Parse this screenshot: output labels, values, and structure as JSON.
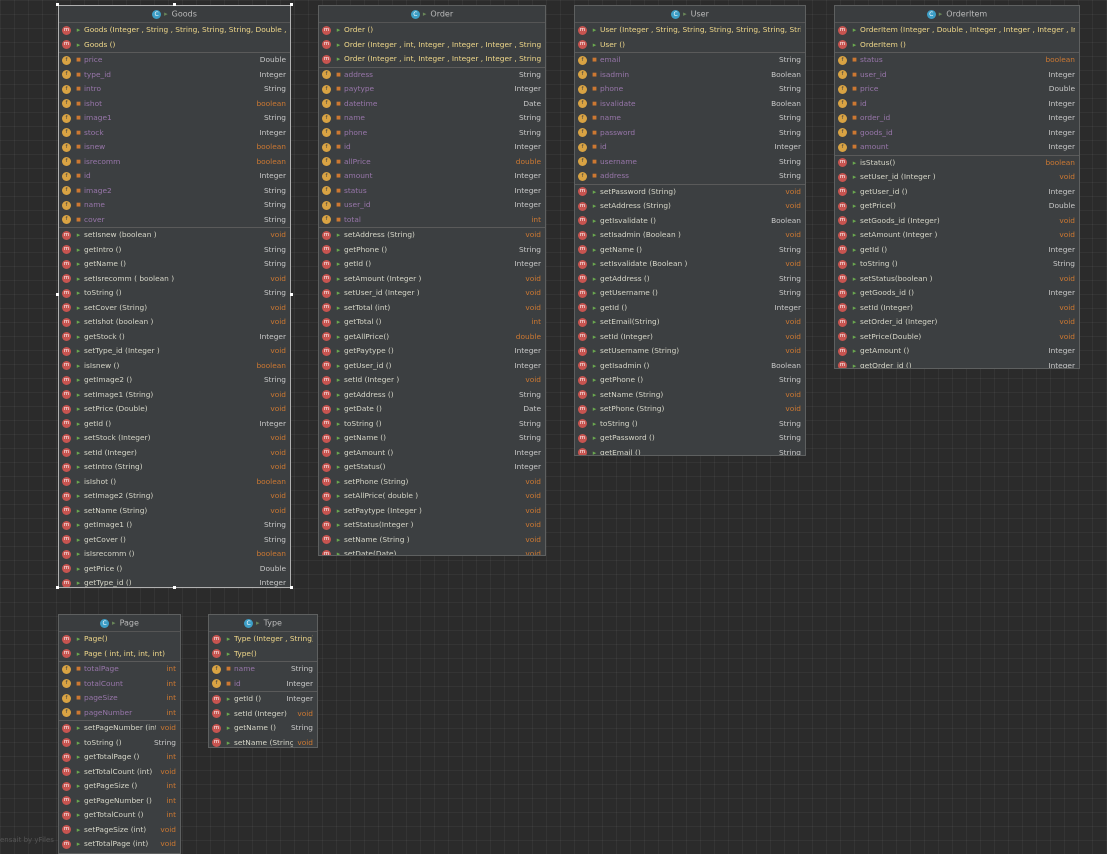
{
  "classes": [
    {
      "id": "goods",
      "name": "Goods",
      "class_icon": "C",
      "constructors": [
        "Goods (Integer , String , String, String, String, Double , Strir",
        "Goods ()"
      ],
      "fields": [
        {
          "name": "price",
          "type": "Double"
        },
        {
          "name": "type_id",
          "type": "Integer"
        },
        {
          "name": "intro",
          "type": "String"
        },
        {
          "name": "ishot",
          "type": "boolean"
        },
        {
          "name": "image1",
          "type": "String"
        },
        {
          "name": "stock",
          "type": "Integer"
        },
        {
          "name": "isnew",
          "type": "boolean"
        },
        {
          "name": "isrecomm",
          "type": "boolean"
        },
        {
          "name": "id",
          "type": "Integer"
        },
        {
          "name": "image2",
          "type": "String"
        },
        {
          "name": "name",
          "type": "String"
        },
        {
          "name": "cover",
          "type": "String"
        }
      ],
      "methods": [
        {
          "name": "setIsnew (boolean )",
          "type": "void"
        },
        {
          "name": "getIntro ()",
          "type": "String"
        },
        {
          "name": "getName ()",
          "type": "String"
        },
        {
          "name": "setIsrecomm ( boolean )",
          "type": "void"
        },
        {
          "name": "toString ()",
          "type": "String"
        },
        {
          "name": "setCover (String)",
          "type": "void"
        },
        {
          "name": "setIshot (boolean )",
          "type": "void"
        },
        {
          "name": "getStock ()",
          "type": "Integer"
        },
        {
          "name": "setType_id (Integer )",
          "type": "void"
        },
        {
          "name": "isIsnew ()",
          "type": "boolean"
        },
        {
          "name": "getImage2 ()",
          "type": "String"
        },
        {
          "name": "setImage1 (String)",
          "type": "void"
        },
        {
          "name": "setPrice (Double)",
          "type": "void"
        },
        {
          "name": "getId ()",
          "type": "Integer"
        },
        {
          "name": "setStock (Integer)",
          "type": "void"
        },
        {
          "name": "setId (Integer)",
          "type": "void"
        },
        {
          "name": "setIntro (String)",
          "type": "void"
        },
        {
          "name": "isIshot ()",
          "type": "boolean"
        },
        {
          "name": "setImage2 (String)",
          "type": "void"
        },
        {
          "name": "setName (String)",
          "type": "void"
        },
        {
          "name": "getImage1 ()",
          "type": "String"
        },
        {
          "name": "getCover ()",
          "type": "String"
        },
        {
          "name": "isIsrecomm ()",
          "type": "boolean"
        },
        {
          "name": "getPrice ()",
          "type": "Double"
        },
        {
          "name": "getType_id ()",
          "type": "Integer"
        }
      ]
    },
    {
      "id": "order",
      "name": "Order",
      "class_icon": "C",
      "constructors": [
        "Order ()",
        "Order (Integer , int, Integer , Integer , Integer , String , Strir",
        "Order (Integer , int, Integer , Integer , Integer , String , Strir"
      ],
      "fields": [
        {
          "name": "address",
          "type": "String"
        },
        {
          "name": "paytype",
          "type": "Integer"
        },
        {
          "name": "datetime",
          "type": "Date"
        },
        {
          "name": "name",
          "type": "String"
        },
        {
          "name": "phone",
          "type": "String"
        },
        {
          "name": "id",
          "type": "Integer"
        },
        {
          "name": "allPrice",
          "type": "double"
        },
        {
          "name": "amount",
          "type": "Integer"
        },
        {
          "name": "status",
          "type": "Integer"
        },
        {
          "name": "user_id",
          "type": "Integer"
        },
        {
          "name": "total",
          "type": "int"
        }
      ],
      "methods": [
        {
          "name": "setAddress (String)",
          "type": "void"
        },
        {
          "name": "getPhone ()",
          "type": "String"
        },
        {
          "name": "getId ()",
          "type": "Integer"
        },
        {
          "name": "setAmount (Integer )",
          "type": "void"
        },
        {
          "name": "setUser_id (Integer )",
          "type": "void"
        },
        {
          "name": "setTotal (int)",
          "type": "void"
        },
        {
          "name": "getTotal ()",
          "type": "int"
        },
        {
          "name": "getAllPrice()",
          "type": "double"
        },
        {
          "name": "getPaytype ()",
          "type": "Integer"
        },
        {
          "name": "getUser_id ()",
          "type": "Integer"
        },
        {
          "name": "setId (Integer )",
          "type": "void"
        },
        {
          "name": "getAddress ()",
          "type": "String"
        },
        {
          "name": "getDate ()",
          "type": "Date"
        },
        {
          "name": "toString ()",
          "type": "String"
        },
        {
          "name": "getName ()",
          "type": "String"
        },
        {
          "name": "getAmount ()",
          "type": "Integer"
        },
        {
          "name": "getStatus()",
          "type": "Integer"
        },
        {
          "name": "setPhone (String)",
          "type": "void"
        },
        {
          "name": "setAllPrice( double )",
          "type": "void"
        },
        {
          "name": "setPaytype (Integer )",
          "type": "void"
        },
        {
          "name": "setStatus(Integer )",
          "type": "void"
        },
        {
          "name": "setName (String )",
          "type": "void"
        },
        {
          "name": "setDate(Date)",
          "type": "void"
        }
      ]
    },
    {
      "id": "user",
      "name": "User",
      "class_icon": "C",
      "constructors": [
        "User (Integer , String, String, String, String, String, String,",
        "User ()"
      ],
      "fields": [
        {
          "name": "email",
          "type": "String"
        },
        {
          "name": "isadmin",
          "type": "Boolean"
        },
        {
          "name": "phone",
          "type": "String"
        },
        {
          "name": "isvalidate",
          "type": "Boolean"
        },
        {
          "name": "name",
          "type": "String"
        },
        {
          "name": "password",
          "type": "String"
        },
        {
          "name": "id",
          "type": "Integer"
        },
        {
          "name": "username",
          "type": "String"
        },
        {
          "name": "address",
          "type": "String"
        }
      ],
      "methods": [
        {
          "name": "setPassword (String)",
          "type": "void"
        },
        {
          "name": "setAddress (String)",
          "type": "void"
        },
        {
          "name": "getIsvalidate ()",
          "type": "Boolean"
        },
        {
          "name": "setIsadmin (Boolean )",
          "type": "void"
        },
        {
          "name": "getName ()",
          "type": "String"
        },
        {
          "name": "setIsvalidate (Boolean )",
          "type": "void"
        },
        {
          "name": "getAddress ()",
          "type": "String"
        },
        {
          "name": "getUsername ()",
          "type": "String"
        },
        {
          "name": "getId ()",
          "type": "Integer"
        },
        {
          "name": "setEmail(String)",
          "type": "void"
        },
        {
          "name": "setId (Integer)",
          "type": "void"
        },
        {
          "name": "setUsername (String)",
          "type": "void"
        },
        {
          "name": "getIsadmin ()",
          "type": "Boolean"
        },
        {
          "name": "getPhone ()",
          "type": "String"
        },
        {
          "name": "setName (String)",
          "type": "void"
        },
        {
          "name": "setPhone (String)",
          "type": "void"
        },
        {
          "name": "toString ()",
          "type": "String"
        },
        {
          "name": "getPassword ()",
          "type": "String"
        },
        {
          "name": "getEmail ()",
          "type": "String"
        }
      ]
    },
    {
      "id": "orderitem",
      "name": "OrderItem",
      "class_icon": "C",
      "constructors": [
        "OrderItem (Integer , Double , Integer , Integer , Integer , Integer",
        "OrderItem ()"
      ],
      "fields": [
        {
          "name": "status",
          "type": "boolean"
        },
        {
          "name": "user_id",
          "type": "Integer"
        },
        {
          "name": "price",
          "type": "Double"
        },
        {
          "name": "id",
          "type": "Integer"
        },
        {
          "name": "order_id",
          "type": "Integer"
        },
        {
          "name": "goods_id",
          "type": "Integer"
        },
        {
          "name": "amount",
          "type": "Integer"
        }
      ],
      "methods": [
        {
          "name": "isStatus()",
          "type": "boolean"
        },
        {
          "name": "setUser_id (Integer )",
          "type": "void"
        },
        {
          "name": "getUser_id ()",
          "type": "Integer"
        },
        {
          "name": "getPrice()",
          "type": "Double"
        },
        {
          "name": "setGoods_id (Integer)",
          "type": "void"
        },
        {
          "name": "setAmount (Integer )",
          "type": "void"
        },
        {
          "name": "getId ()",
          "type": "Integer"
        },
        {
          "name": "toString ()",
          "type": "String"
        },
        {
          "name": "setStatus(boolean )",
          "type": "void"
        },
        {
          "name": "getGoods_id ()",
          "type": "Integer"
        },
        {
          "name": "setId (Integer)",
          "type": "void"
        },
        {
          "name": "setOrder_id (Integer)",
          "type": "void"
        },
        {
          "name": "setPrice(Double)",
          "type": "void"
        },
        {
          "name": "getAmount ()",
          "type": "Integer"
        },
        {
          "name": "getOrder_id ()",
          "type": "Integer"
        }
      ]
    },
    {
      "id": "page",
      "name": "Page",
      "class_icon": "C",
      "constructors": [
        "Page()",
        "Page ( int, int, int, int)"
      ],
      "fields": [
        {
          "name": "totalPage",
          "type": "int"
        },
        {
          "name": "totalCount",
          "type": "int"
        },
        {
          "name": "pageSize",
          "type": "int"
        },
        {
          "name": "pageNumber",
          "type": "int"
        }
      ],
      "methods": [
        {
          "name": "setPageNumber (int)",
          "type": "void"
        },
        {
          "name": "toString ()",
          "type": "String"
        },
        {
          "name": "getTotalPage ()",
          "type": "int"
        },
        {
          "name": "setTotalCount (int)",
          "type": "void"
        },
        {
          "name": "getPageSize ()",
          "type": "int"
        },
        {
          "name": "getPageNumber ()",
          "type": "int"
        },
        {
          "name": "getTotalCount ()",
          "type": "int"
        },
        {
          "name": "setPageSize (int)",
          "type": "void"
        },
        {
          "name": "setTotalPage (int)",
          "type": "void"
        }
      ]
    },
    {
      "id": "type",
      "name": "Type",
      "class_icon": "C",
      "constructors": [
        "Type (Integer , String)",
        "Type()"
      ],
      "fields": [
        {
          "name": "name",
          "type": "String"
        },
        {
          "name": "id",
          "type": "Integer"
        }
      ],
      "methods": [
        {
          "name": "getId ()",
          "type": "Integer"
        },
        {
          "name": "setId (Integer)",
          "type": "void"
        },
        {
          "name": "getName ()",
          "type": "String"
        },
        {
          "name": "setName (String)",
          "type": "void"
        }
      ]
    }
  ],
  "icons": {
    "class": "class-icon",
    "method": "method-icon",
    "field": "field-icon",
    "public": "public-access-icon",
    "private": "private-access-icon"
  },
  "watermark": "ensait by yFiles"
}
